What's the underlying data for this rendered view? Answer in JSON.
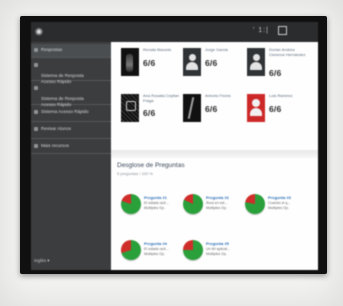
{
  "topbar": {
    "clock": "' 1:|",
    "home_icon": "home-icon",
    "fullscreen_icon": "fullscreen-icon"
  },
  "sidebar": {
    "items": [
      {
        "label": "Respostas"
      },
      {
        "label": "Sistema de Resposta\nAcesso Rápido"
      },
      {
        "label": "Sistema de Resposta\nAcesso Rápido"
      },
      {
        "label": "Sistema Acesso Rápido"
      },
      {
        "label": "Revisar Alunos"
      },
      {
        "label": "Mais recursos"
      }
    ],
    "footer": "Inglés ▾"
  },
  "students": [
    {
      "name": "Renata Macedo",
      "score": "6/6",
      "avatar": "photo-dark"
    },
    {
      "name": "Jorge Garcia",
      "score": "6/6",
      "avatar": "silhouette"
    },
    {
      "name": "Dorian Andrea Cisneros Hernández",
      "score": "6/6",
      "avatar": "silhouette"
    },
    {
      "name": "Ana Rosalia Ceyllan Fraga",
      "score": "6/6",
      "avatar": "pattern"
    },
    {
      "name": "Antonio Flores",
      "score": "6/6",
      "avatar": "line-photo"
    },
    {
      "name": "Luis Ramírez",
      "score": "6/6",
      "avatar": "red"
    }
  ],
  "questions_section": {
    "title": "Desglose de Preguntas",
    "subtitle": "5 preguntas / 100 %"
  },
  "questions": [
    {
      "title": "Pregunta #1",
      "line1": "El estado acti...",
      "line2": "Multiples Op.",
      "correct_pct": 80
    },
    {
      "title": "Pregunta #2",
      "line1": "Área en est...",
      "line2": "Multiples Op.",
      "correct_pct": 82
    },
    {
      "title": "Pregunta #3",
      "line1": "Cuando el q...",
      "line2": "Multiples Op.",
      "correct_pct": 78
    },
    {
      "title": "Pregunta #4",
      "line1": "El estado acti...",
      "line2": "Multiples Op.",
      "correct_pct": 70
    },
    {
      "title": "Pregunta #5",
      "line1": "Un tirt aplicat...",
      "line2": "Multiples Op.",
      "correct_pct": 75
    }
  ],
  "colors": {
    "correct": "#2e9e3e",
    "incorrect": "#c9302c",
    "sidebar": "#3b3d3f",
    "topbar": "#2a2c2e"
  }
}
